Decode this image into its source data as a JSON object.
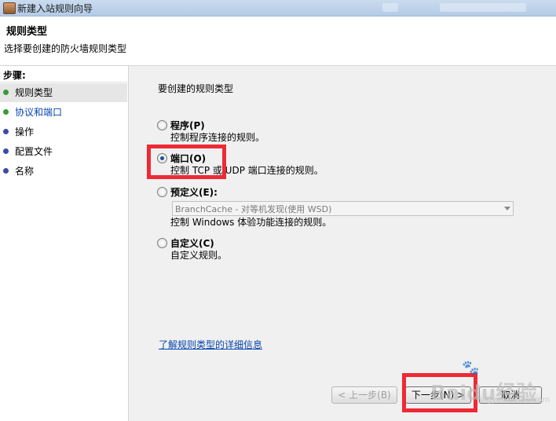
{
  "window": {
    "title": "新建入站规则向导"
  },
  "header": {
    "title": "规则类型",
    "subtitle": "选择要创建的防火墙规则类型"
  },
  "sidebar": {
    "heading": "步骤:",
    "steps": [
      {
        "label": "规则类型",
        "bullet_color": "#3a9a3a"
      },
      {
        "label": "协议和端口",
        "bullet_color": "#3a9a3a"
      },
      {
        "label": "操作",
        "bullet_color": "#3d4aa8"
      },
      {
        "label": "配置文件",
        "bullet_color": "#3d4aa8"
      },
      {
        "label": "名称",
        "bullet_color": "#3d4aa8"
      }
    ]
  },
  "main": {
    "question": "要创建的规则类型",
    "options": [
      {
        "label": "程序(P)",
        "description": "控制程序连接的规则。",
        "checked": false
      },
      {
        "label": "端口(O)",
        "description": "控制 TCP 或 UDP 端口连接的规则。",
        "checked": true
      },
      {
        "label": "预定义(E):",
        "description": "控制 Windows 体验功能连接的规则。",
        "checked": false
      },
      {
        "label": "自定义(C)",
        "description": "自定义规则。",
        "checked": false
      }
    ],
    "predefined_select": {
      "value": "BranchCache - 对等机发现(使用 WSD)"
    },
    "learn_more_link": "了解规则类型的详细信息"
  },
  "footer": {
    "back_label": "< 上一步(B)",
    "next_label": "下一步(N) >",
    "cancel_label": "取消"
  },
  "watermark": {
    "text": "Baidu经验",
    "sub": "jingyan.baidu.com"
  },
  "colors": {
    "highlight": "#ed2a35",
    "link": "#0645ad",
    "radio_selected": "#1a4f9c"
  }
}
